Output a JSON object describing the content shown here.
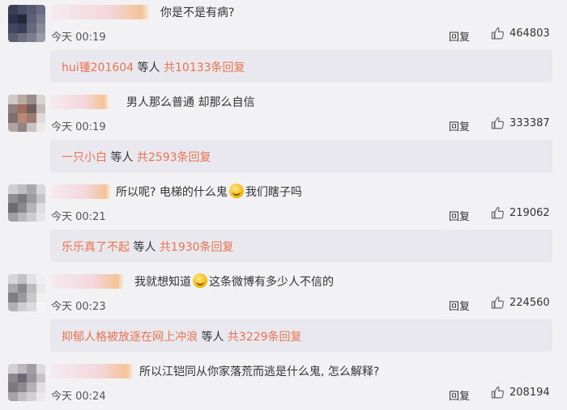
{
  "comments": [
    {
      "text_before": "你是不是有病?",
      "emoji": "",
      "text_after": "",
      "time": "今天 00:19",
      "reply_label": "回复",
      "likes": "464803",
      "sub_user": "hui锺201604",
      "sub_mid": " 等人 ",
      "sub_count": "共10133条回复"
    },
    {
      "text_before": "男人那么普通 却那么自信",
      "emoji": "",
      "text_after": "",
      "time": "今天 00:19",
      "reply_label": "回复",
      "likes": "333387",
      "sub_user": "一只小白",
      "sub_mid": " 等人 ",
      "sub_count": "共2593条回复"
    },
    {
      "text_before": "所以呢? 电梯的什么鬼",
      "emoji": "grinning-emoji",
      "text_after": "我们瞎子吗",
      "time": "今天 00:21",
      "reply_label": "回复",
      "likes": "219062",
      "sub_user": "乐乐真了不起",
      "sub_mid": " 等人 ",
      "sub_count": "共1930条回复"
    },
    {
      "text_before": "我就想知道",
      "emoji": "smiling-emoji",
      "text_after": "这条微博有多少人不信的",
      "time": "今天 00:23",
      "reply_label": "回复",
      "likes": "224560",
      "sub_user": "抑郁人格被放逐在网上冲浪",
      "sub_mid": " 等人 ",
      "sub_count": "共3229条回复"
    },
    {
      "text_before": "所以江铠同从你家落荒而逃是什么鬼, 怎么解释?",
      "emoji": "",
      "text_after": "",
      "time": "今天 00:24",
      "reply_label": "回复",
      "likes": "208194",
      "sub_user": "",
      "sub_mid": "",
      "sub_count": ""
    }
  ],
  "colors": {
    "accent": "#eb7350",
    "background": "#f2f2f5",
    "subbox": "#e8e8ee"
  }
}
